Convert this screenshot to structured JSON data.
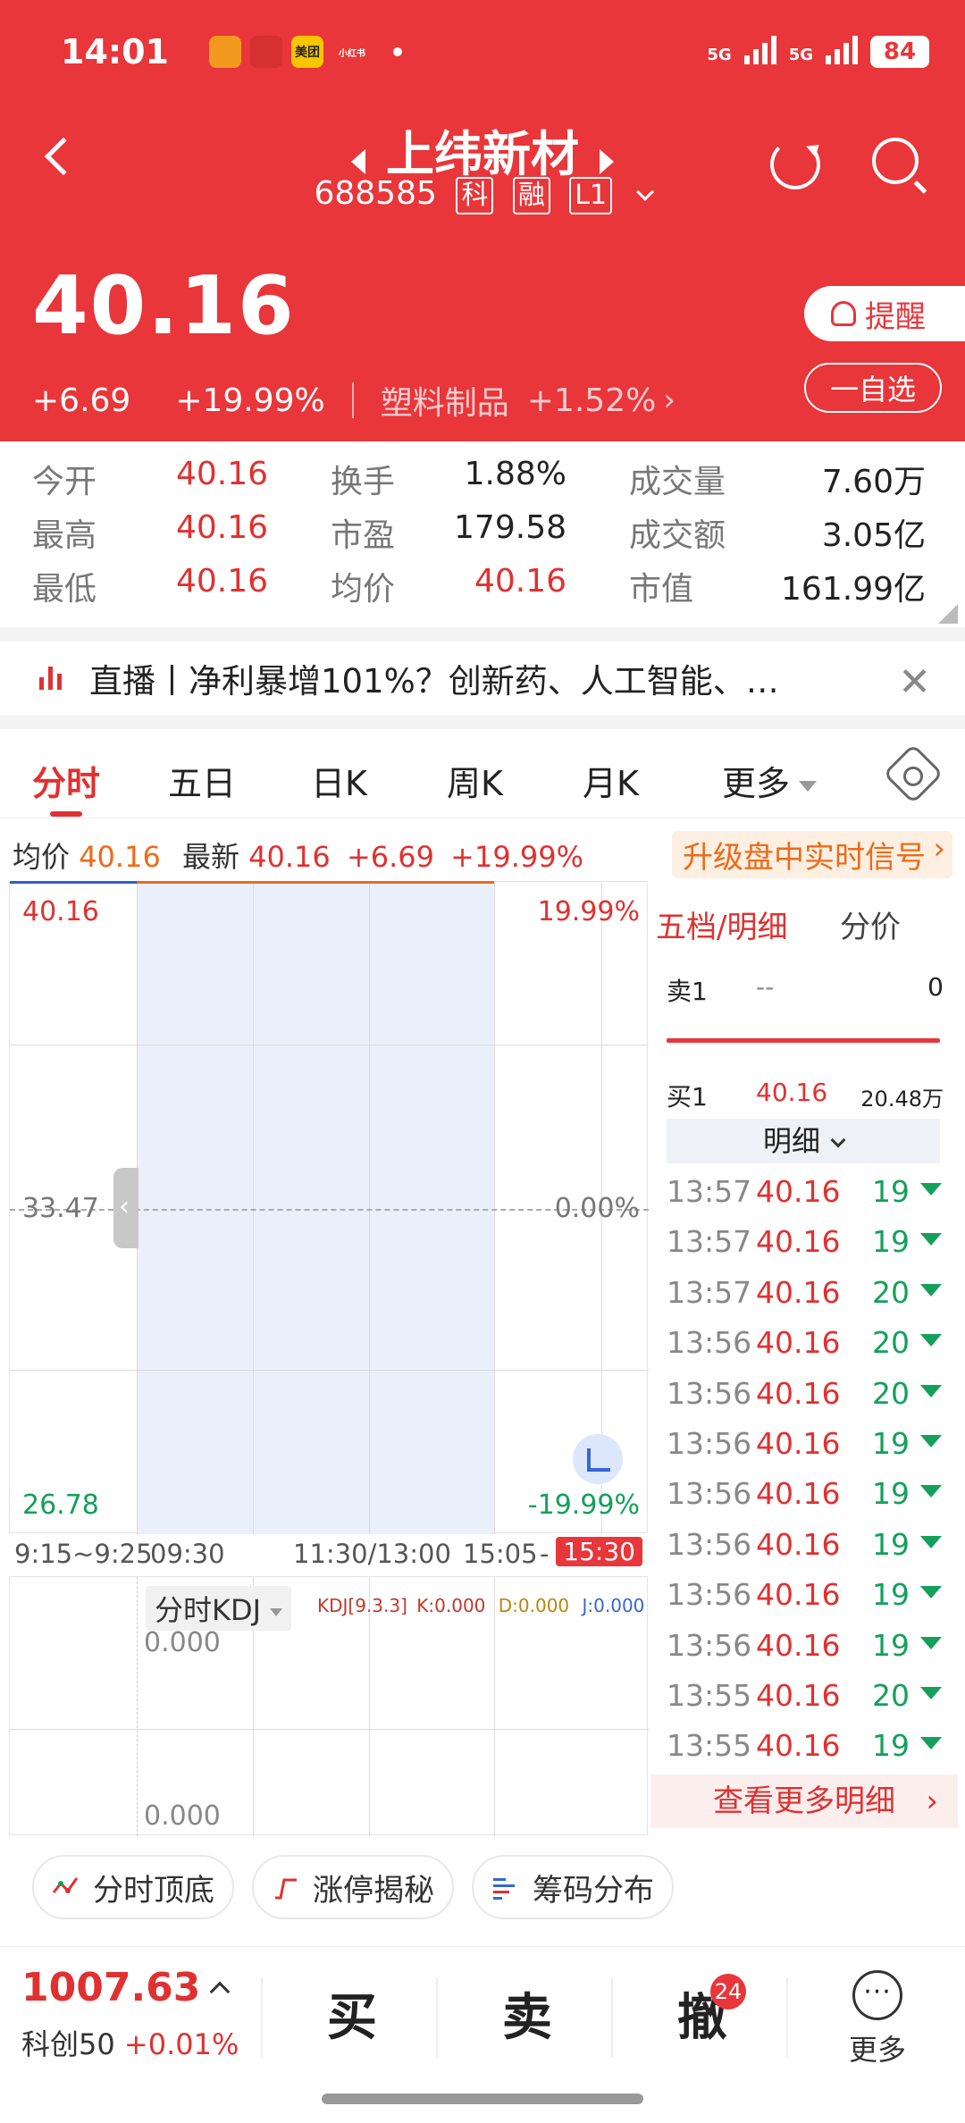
{
  "status_bar": {
    "time": "14:01",
    "app_icons": [
      {
        "label": "",
        "color": "#e8363a",
        "name": "app-icon-1"
      },
      {
        "label": "",
        "color": "#f39a1e",
        "name": "app-icon-2"
      },
      {
        "label": "",
        "color": "#d63030",
        "name": "app-icon-3"
      },
      {
        "label": "美团",
        "color": "#f7c600",
        "name": "meituan-icon"
      },
      {
        "label": "小红书",
        "color": "#e8363a",
        "name": "xiaohongshu-icon"
      }
    ],
    "signal_1": "5G",
    "signal_2": "5G",
    "battery": "84"
  },
  "header": {
    "stock_name": "上纬新材",
    "stock_code": "688585",
    "tags": [
      "科",
      "融",
      "L1"
    ],
    "price": "40.16",
    "change": "+6.69",
    "change_pct": "+19.99%",
    "sector": "塑料制品",
    "sector_pct": "+1.52%",
    "remind_label": "提醒",
    "watchlist_label": "一自选"
  },
  "stats": {
    "rows": [
      [
        {
          "label": "今开",
          "value": "40.16",
          "color": "red"
        },
        {
          "label": "换手",
          "value": "1.88%",
          "color": "dark"
        },
        {
          "label": "成交量",
          "value": "7.60万",
          "color": "dark"
        }
      ],
      [
        {
          "label": "最高",
          "value": "40.16",
          "color": "red"
        },
        {
          "label": "市盈",
          "value": "179.58",
          "color": "dark"
        },
        {
          "label": "成交额",
          "value": "3.05亿",
          "color": "dark"
        }
      ],
      [
        {
          "label": "最低",
          "value": "40.16",
          "color": "red"
        },
        {
          "label": "均价",
          "value": "40.16",
          "color": "red"
        },
        {
          "label": "市值",
          "value": "161.99亿",
          "color": "dark"
        }
      ]
    ]
  },
  "news": {
    "text": "直播丨净利暴增101%？创新药、人工智能、…",
    "close": "✕"
  },
  "tabs": [
    "分时",
    "五日",
    "日K",
    "周K",
    "月K",
    "更多"
  ],
  "infobar": {
    "avg_label": "均价",
    "avg_value": "40.16",
    "latest_label": "最新",
    "latest_value": "40.16",
    "change": "+6.69",
    "change_pct": "+19.99%",
    "promo": "升级盘中实时信号"
  },
  "chart": {
    "y_top_left": "40.16",
    "y_top_right": "19.99%",
    "y_mid_left": "33.47",
    "y_mid_right": "0.00%",
    "y_bot_left": "26.78",
    "y_bot_right": "-19.99%",
    "time_labels": [
      "9:15~9:25",
      "09:30",
      "11:30/13:00",
      "15:05",
      "-",
      "15:30"
    ],
    "kdj_selector": "分时KDJ",
    "kdj_name": "KDJ[9.3.3]",
    "kdj_k": "K:0.000",
    "kdj_d": "D:0.000",
    "kdj_j": "J:0.000",
    "kdj_top": "0.000",
    "kdj_bot": "0.000"
  },
  "panel": {
    "tab_1": "五档/明细",
    "tab_2": "分价",
    "sell1": {
      "label": "卖1",
      "price": "--",
      "vol": "0"
    },
    "buy1": {
      "label": "买1",
      "price": "40.16",
      "vol": "20.48万"
    },
    "detail_header": "明细",
    "ticks": [
      {
        "time": "13:57",
        "price": "40.16",
        "vol": "19"
      },
      {
        "time": "13:57",
        "price": "40.16",
        "vol": "19"
      },
      {
        "time": "13:57",
        "price": "40.16",
        "vol": "20"
      },
      {
        "time": "13:56",
        "price": "40.16",
        "vol": "20"
      },
      {
        "time": "13:56",
        "price": "40.16",
        "vol": "20"
      },
      {
        "time": "13:56",
        "price": "40.16",
        "vol": "19"
      },
      {
        "time": "13:56",
        "price": "40.16",
        "vol": "19"
      },
      {
        "time": "13:56",
        "price": "40.16",
        "vol": "19"
      },
      {
        "time": "13:56",
        "price": "40.16",
        "vol": "19"
      },
      {
        "time": "13:56",
        "price": "40.16",
        "vol": "19"
      },
      {
        "time": "13:55",
        "price": "40.16",
        "vol": "20"
      },
      {
        "time": "13:55",
        "price": "40.16",
        "vol": "19"
      }
    ],
    "more_detail": "查看更多明细"
  },
  "chips": [
    {
      "label": "分时顶底",
      "name": "chip-intraday-top-bottom"
    },
    {
      "label": "涨停揭秘",
      "name": "chip-limit-up-reveal"
    },
    {
      "label": "筹码分布",
      "name": "chip-chip-distribution"
    }
  ],
  "bottom": {
    "index_value": "1007.63",
    "index_name": "科创50",
    "index_change": "+0.01%",
    "buy": "买",
    "sell": "卖",
    "cancel": "撤",
    "cancel_badge": "24",
    "more_icon": "···",
    "more": "更多"
  }
}
